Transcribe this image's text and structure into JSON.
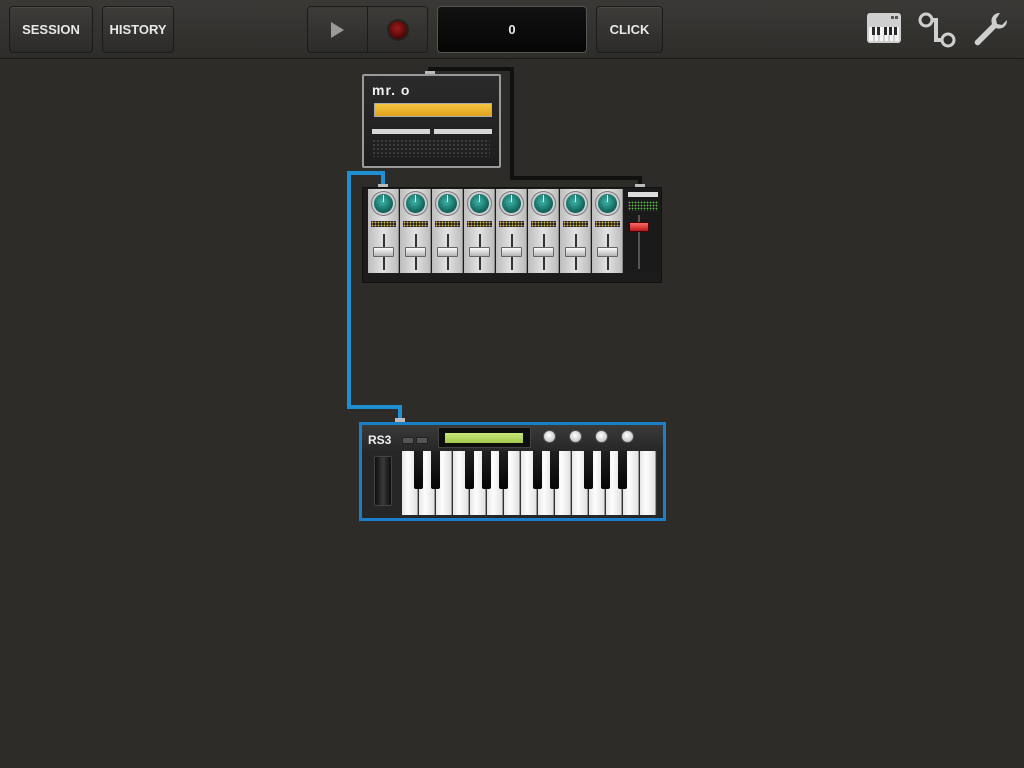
{
  "toolbar": {
    "session_label": "SESSION",
    "history_label": "HISTORY",
    "counter_value": "0",
    "click_label": "CLICK"
  },
  "icons": {
    "play": "play-icon",
    "record": "record-icon",
    "keyboard": "keyboard-icon",
    "routing": "routing-icon",
    "settings": "wrench-icon"
  },
  "devices": {
    "mro": {
      "logo": "mr. o"
    },
    "rs3": {
      "logo": "RS3"
    }
  },
  "colors": {
    "accent_cable": "#1e8fd0",
    "selection": "#1a7fc6",
    "mro_display": "#f2b733",
    "rs3_lcd": "#b6d865",
    "knob": "#2a9a8e"
  }
}
